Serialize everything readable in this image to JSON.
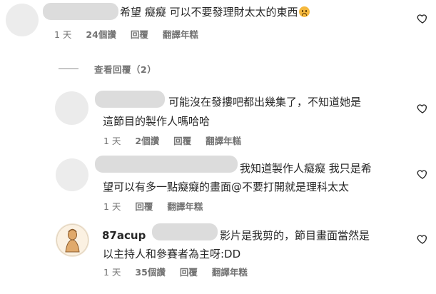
{
  "comments": [
    {
      "text_lines": [
        "希望 癡癡 可以不要發理財太太的東西"
      ],
      "has_sad_emoji": true,
      "meta": {
        "time": "1 天",
        "likes": "24個讚",
        "reply": "回覆",
        "translate": "翻譯年糕"
      }
    },
    {
      "text_lines": [
        "可能沒在發摟吧都出幾集了，不知道她是",
        "這節目的製作人嗎哈哈"
      ],
      "meta": {
        "time": "1 天",
        "likes": "2個讚",
        "reply": "回覆",
        "translate": "翻譯年糕"
      }
    },
    {
      "text_lines": [
        "我知道製作人癡癡 我只是希",
        "望可以有多一點癡癡的畫面@不要打開就是理科太太"
      ],
      "meta": {
        "time": "1 天",
        "reply": "回覆",
        "translate": "翻譯年糕"
      }
    },
    {
      "username": "87acup",
      "text_lines": [
        "影片是我剪的，節目畫面當然是",
        "以主持人和參賽者為主呀:DD"
      ],
      "meta": {
        "time": "1 天",
        "likes": "35個讚",
        "reply": "回覆",
        "translate": "翻譯年糕"
      }
    }
  ],
  "view_replies_label": "查看回覆（2）",
  "icons": {
    "like": "heart-icon",
    "emoji": "sad-face-icon"
  }
}
